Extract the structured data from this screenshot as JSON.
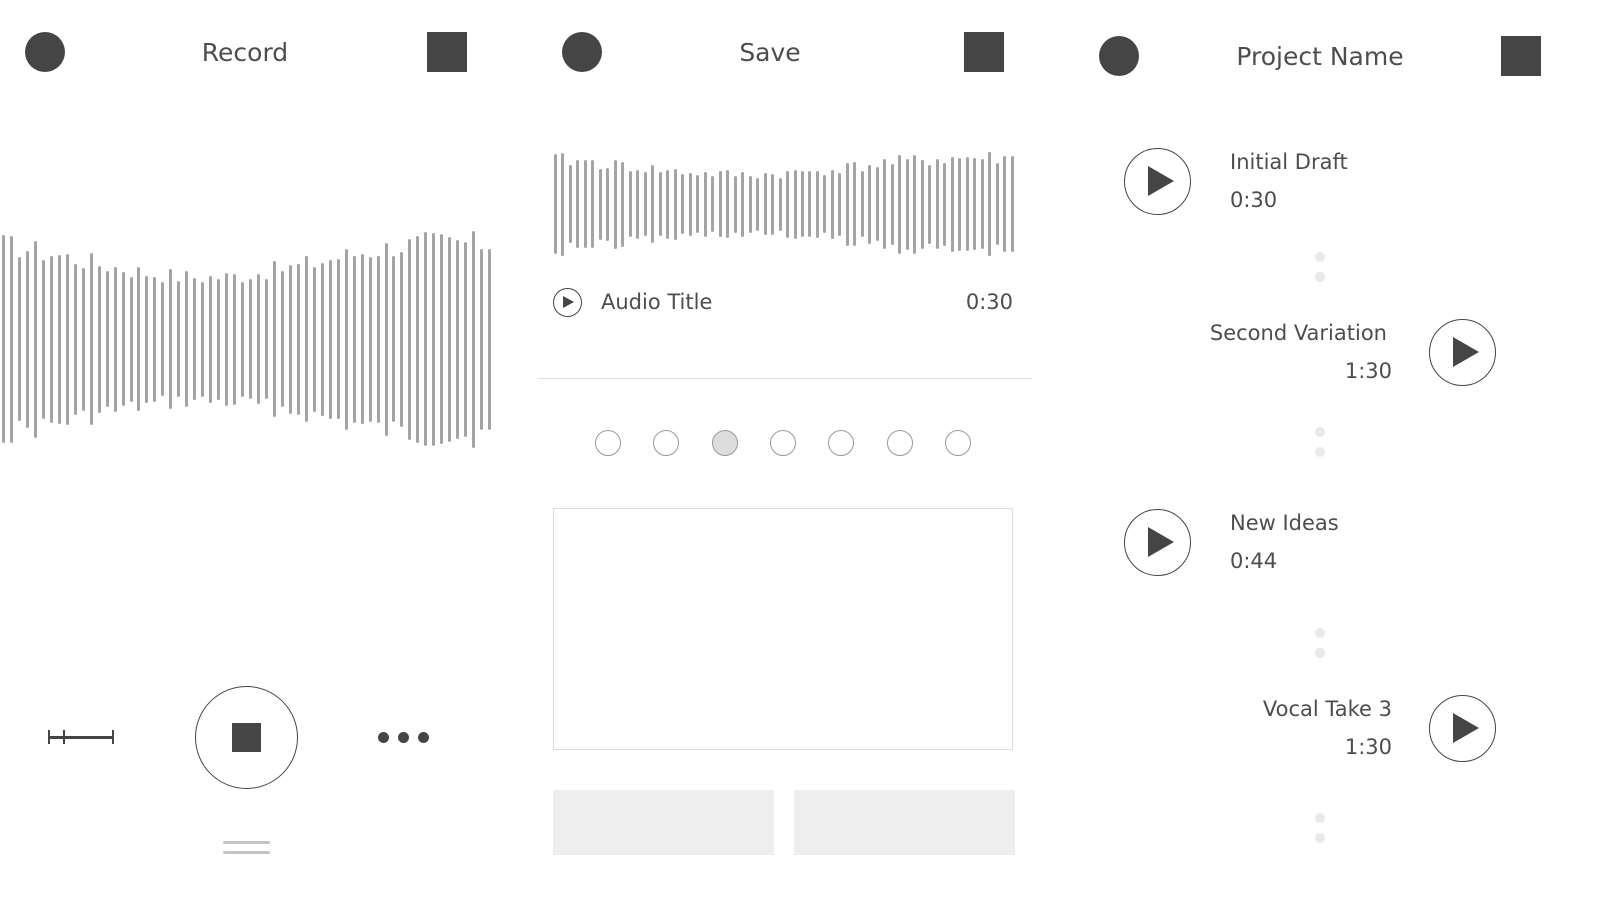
{
  "colors": {
    "dark": "#454545",
    "wave": "#a4a4a4",
    "text": "#4d4d4d",
    "divider": "#e2e2e2",
    "flat_button": "#eeeeee",
    "selected_option": "#dcdcdc"
  },
  "record_screen": {
    "title": "Record",
    "left_icon": "circle-icon",
    "right_icon": "square-icon",
    "controls": {
      "left": "trim-icon",
      "center": "stop-icon",
      "right": "more-icon"
    },
    "bottom_handle": "drag-handle-icon"
  },
  "save_screen": {
    "title": "Save",
    "left_icon": "circle-icon",
    "right_icon": "square-icon",
    "audio": {
      "title": "Audio Title",
      "duration": "0:30"
    },
    "selector": {
      "count": 7,
      "selected_index": 2
    },
    "notes_text": "",
    "buttons": [
      "",
      ""
    ]
  },
  "project_screen": {
    "title": "Project Name",
    "left_icon": "circle-icon",
    "right_icon": "square-icon",
    "takes": [
      {
        "name": "Initial Draft",
        "duration": "0:30",
        "align": "left"
      },
      {
        "name": "Second Variation",
        "duration": "1:30",
        "align": "right"
      },
      {
        "name": "New Ideas",
        "duration": "0:44",
        "align": "left"
      },
      {
        "name": "Vocal Take 3",
        "duration": "1:30",
        "align": "right"
      }
    ]
  }
}
